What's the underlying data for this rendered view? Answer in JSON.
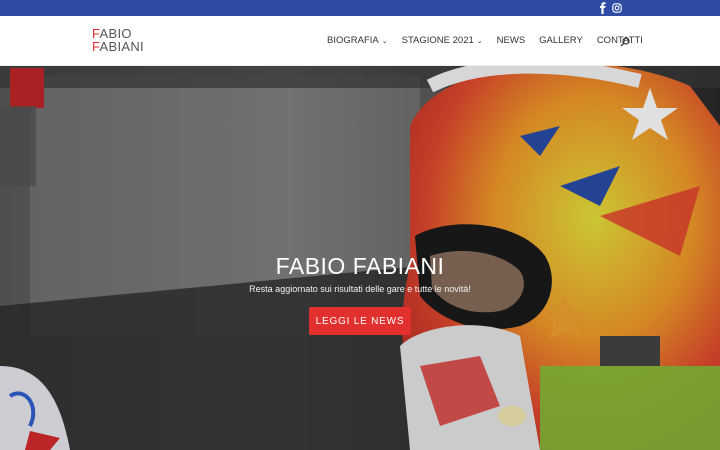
{
  "topbar": {
    "color": "#2f4ba3",
    "icons": [
      "facebook-icon",
      "instagram-icon"
    ]
  },
  "logo": {
    "line1": "FABIO",
    "line2": "FABIANI",
    "accent_color": "#e2302f"
  },
  "nav": {
    "items": [
      {
        "label": "BIOGRAFIA",
        "dropdown": true
      },
      {
        "label": "STAGIONE 2021",
        "dropdown": true
      },
      {
        "label": "NEWS",
        "dropdown": false
      },
      {
        "label": "GALLERY",
        "dropdown": false
      },
      {
        "label": "CONTATTI",
        "dropdown": false
      }
    ],
    "search_icon": "search-icon"
  },
  "hero": {
    "title": "FABIO FABIANI",
    "subtitle": "Resta aggiornato sui risultati delle gare e tutte le novità!",
    "button_label": "LEGGI LE NEWS",
    "button_color": "#e2302f"
  }
}
